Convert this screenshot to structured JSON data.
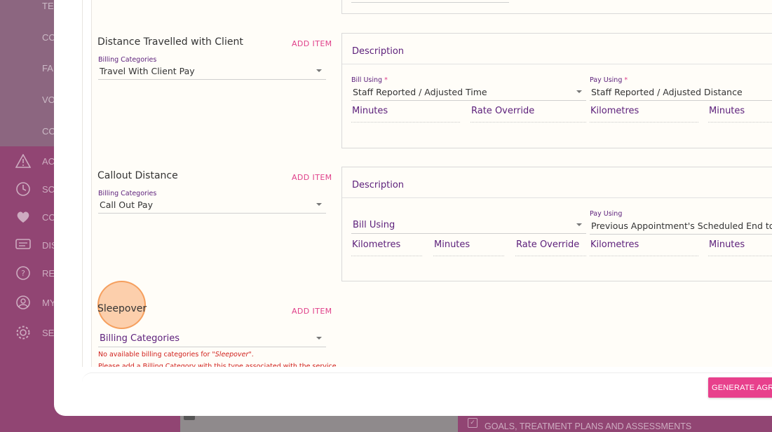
{
  "background": {
    "nav_items": [
      {
        "label": "TE",
        "icon": "none"
      },
      {
        "label": "CO",
        "icon": "none"
      },
      {
        "label": "FA",
        "icon": "none"
      },
      {
        "label": "VO",
        "icon": "none"
      },
      {
        "label": "CO",
        "icon": "none"
      },
      {
        "label": "AC",
        "icon": "warning-triangle-icon"
      },
      {
        "label": "SC",
        "icon": "clock-icon"
      },
      {
        "label": "CO",
        "icon": "hearts-icon"
      },
      {
        "label": "DIS",
        "icon": "chat-icon"
      },
      {
        "label": "RE",
        "icon": "question-icon"
      },
      {
        "label": "MY",
        "icon": "user-icon"
      },
      {
        "label": "SE",
        "icon": "gear-icon"
      }
    ],
    "bottom_panel_label": "GOALS, TREATMENT PLANS AND ASSESSMENTS"
  },
  "sections": {
    "distance": {
      "title": "Distance Travelled with Client",
      "add_item": "ADD ITEM",
      "billing_categories_label": "Billing Categories",
      "billing_categories_value": "Travel With Client Pay",
      "card": {
        "description": "Description",
        "bill_using_label": "Bill Using",
        "bill_using_value": "Staff Reported / Adjusted Time",
        "pay_using_label": "Pay Using",
        "pay_using_value": "Staff Reported / Adjusted Distance",
        "required_mark": "*",
        "fields": [
          "Minutes",
          "Rate Override",
          "Kilometres",
          "Minutes"
        ]
      }
    },
    "callout": {
      "title": "Callout Distance",
      "add_item": "ADD ITEM",
      "billing_categories_label": "Billing Categories",
      "billing_categories_value": "Call Out Pay",
      "card": {
        "description": "Description",
        "bill_using_placeholder": "Bill Using",
        "pay_using_label": "Pay Using",
        "pay_using_value": "Previous Appointment's Scheduled End to C",
        "fields": [
          "Kilometres",
          "Minutes",
          "Rate Override",
          "Kilometres",
          "Minutes"
        ]
      }
    },
    "sleepover": {
      "title": "Sleepover",
      "add_item": "ADD ITEM",
      "billing_categories_placeholder": "Billing Categories",
      "error_prefix": "No available billing categories for ",
      "error_name": "\"Sleepover\"",
      "error_suffix": ".",
      "error_line2": "Please add a Billing Category with this type associated with the service"
    }
  },
  "footer": {
    "generate_button": "GENERATE AGRE"
  },
  "colors": {
    "accent": "#e8408c",
    "label_purple": "#5b1e7a",
    "error_red": "#d0201c",
    "highlight": "#faaa6e"
  }
}
